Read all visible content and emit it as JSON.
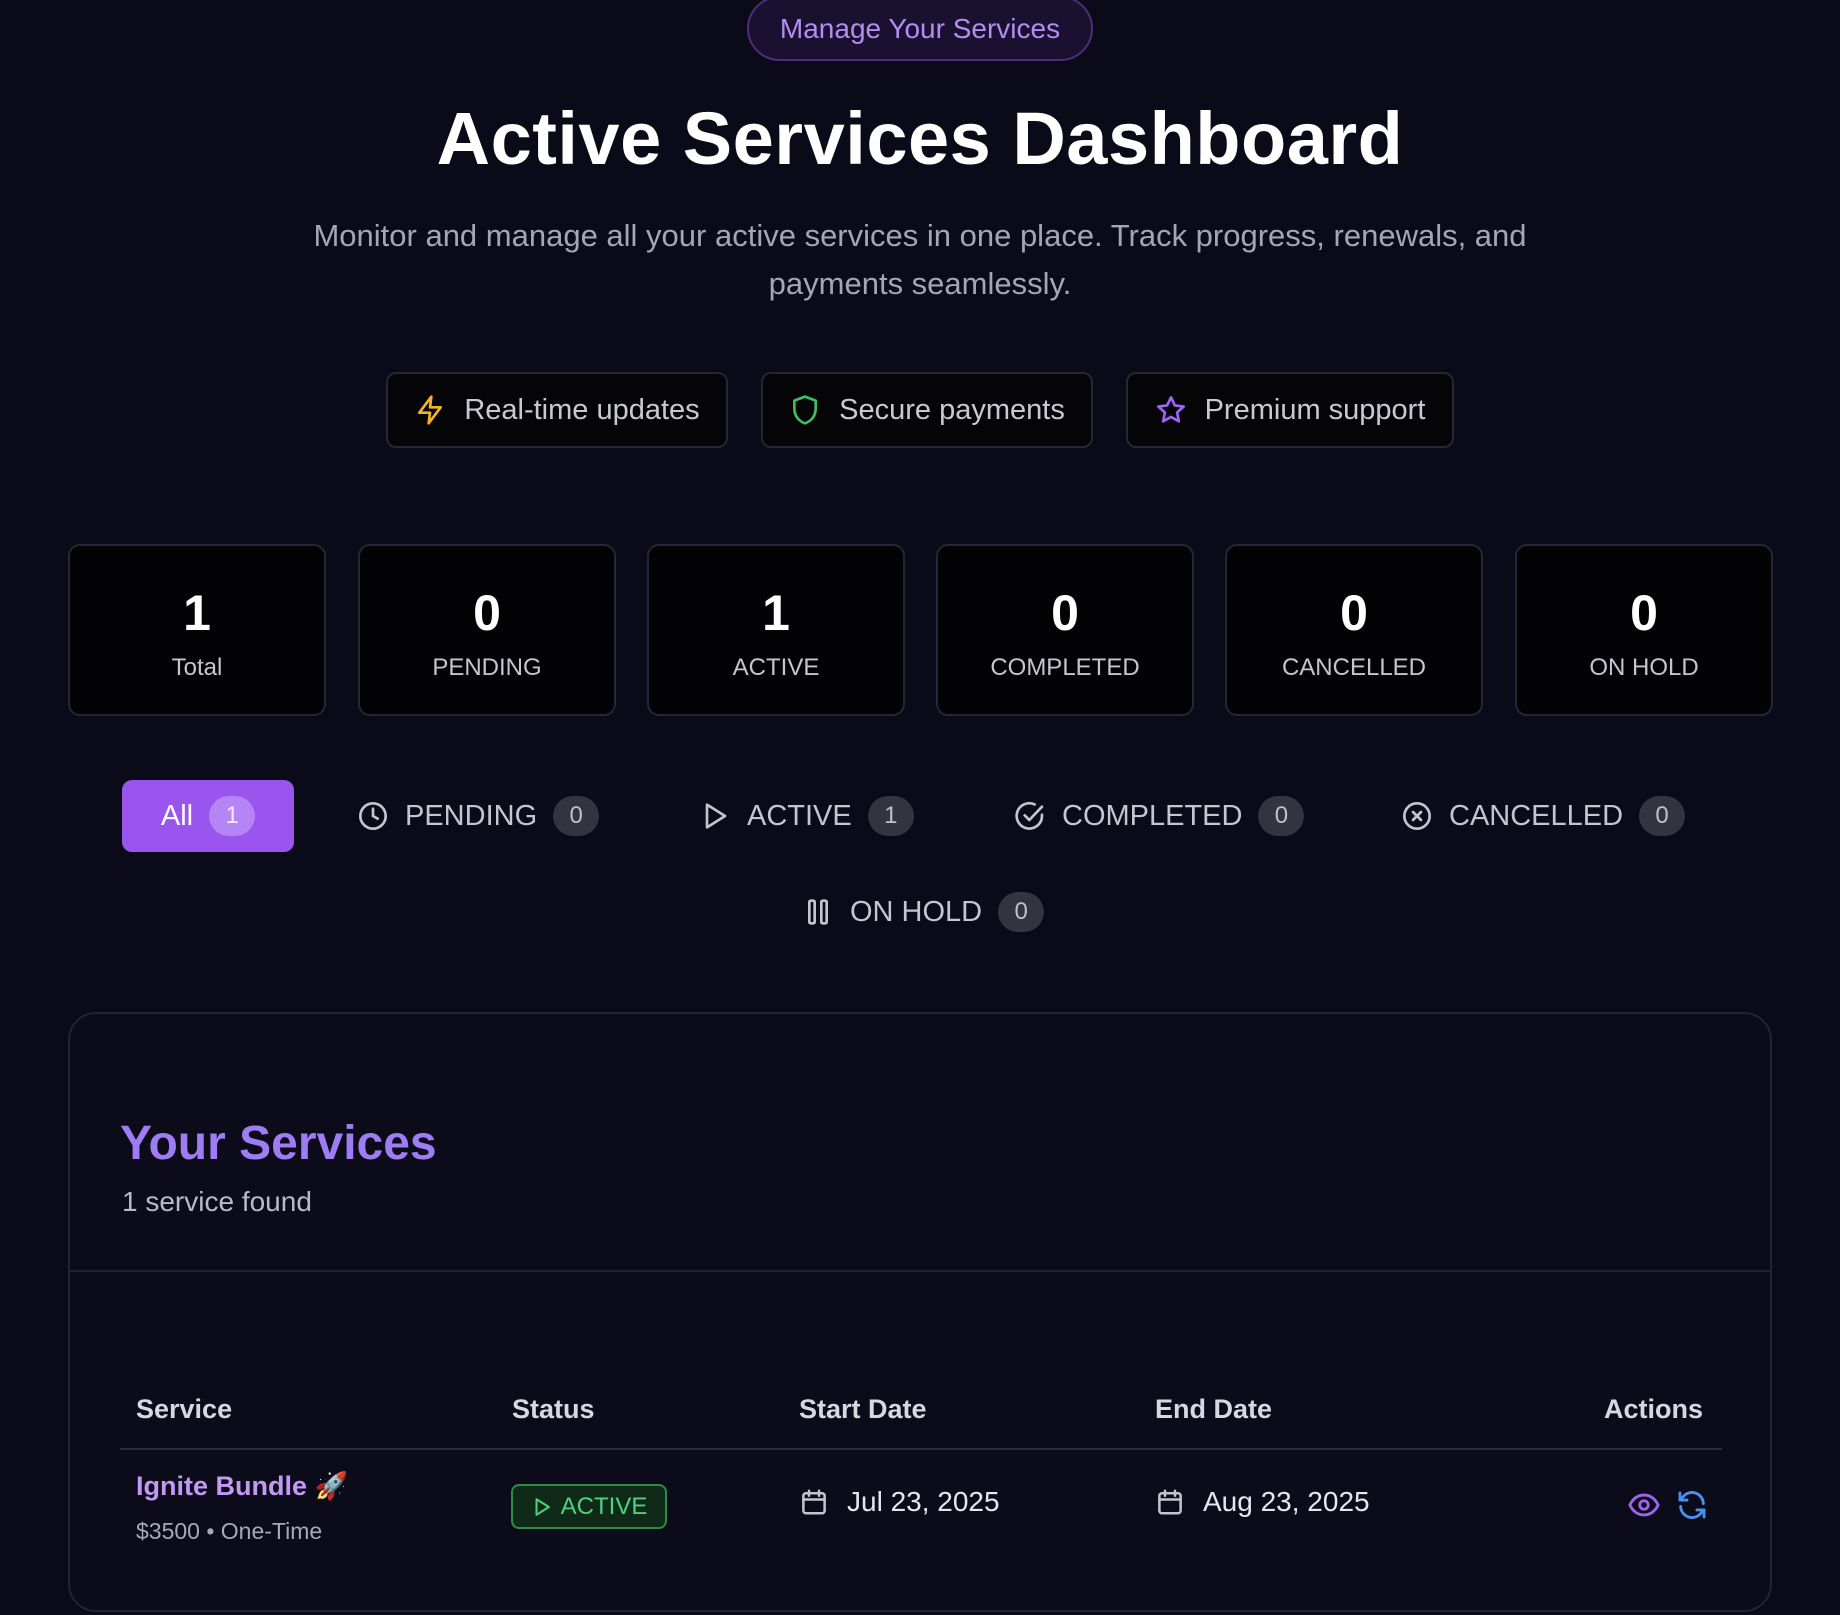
{
  "header": {
    "badge": "Manage Your Services",
    "title": "Active Services Dashboard",
    "subtitle": "Monitor and manage all your active services in one place. Track progress, renewals, and payments seamlessly."
  },
  "features": [
    {
      "label": "Real-time updates",
      "icon": "lightning-icon",
      "color": "#f0b429"
    },
    {
      "label": "Secure payments",
      "icon": "shield-icon",
      "color": "#3fbf5f"
    },
    {
      "label": "Premium support",
      "icon": "star-icon",
      "color": "#a064f0"
    }
  ],
  "stats": [
    {
      "value": "1",
      "label": "Total"
    },
    {
      "value": "0",
      "label": "PENDING"
    },
    {
      "value": "1",
      "label": "ACTIVE"
    },
    {
      "value": "0",
      "label": "COMPLETED"
    },
    {
      "value": "0",
      "label": "CANCELLED"
    },
    {
      "value": "0",
      "label": "ON HOLD"
    }
  ],
  "tabs": [
    {
      "label": "All",
      "count": "1",
      "selected": true
    },
    {
      "label": "PENDING",
      "count": "0",
      "icon": "clock-icon"
    },
    {
      "label": "ACTIVE",
      "count": "1",
      "icon": "play-icon"
    },
    {
      "label": "COMPLETED",
      "count": "0",
      "icon": "check-circle-icon"
    },
    {
      "label": "CANCELLED",
      "count": "0",
      "icon": "x-circle-icon"
    },
    {
      "label": "ON HOLD",
      "count": "0",
      "icon": "pause-icon"
    }
  ],
  "services_panel": {
    "title": "Your Services",
    "count_text": "1 service found",
    "columns": [
      "Service",
      "Status",
      "Start Date",
      "End Date",
      "Actions"
    ],
    "rows": [
      {
        "name": "Ignite Bundle 🚀",
        "meta": "$3500 • One-Time",
        "status": "ACTIVE",
        "start_date": "Jul 23, 2025",
        "end_date": "Aug 23, 2025",
        "actions": [
          "eye-icon",
          "refresh-icon"
        ]
      }
    ]
  },
  "colors": {
    "accent": "#9a55ee",
    "background": "#0a0a18",
    "status_active": "#4fd27a"
  }
}
